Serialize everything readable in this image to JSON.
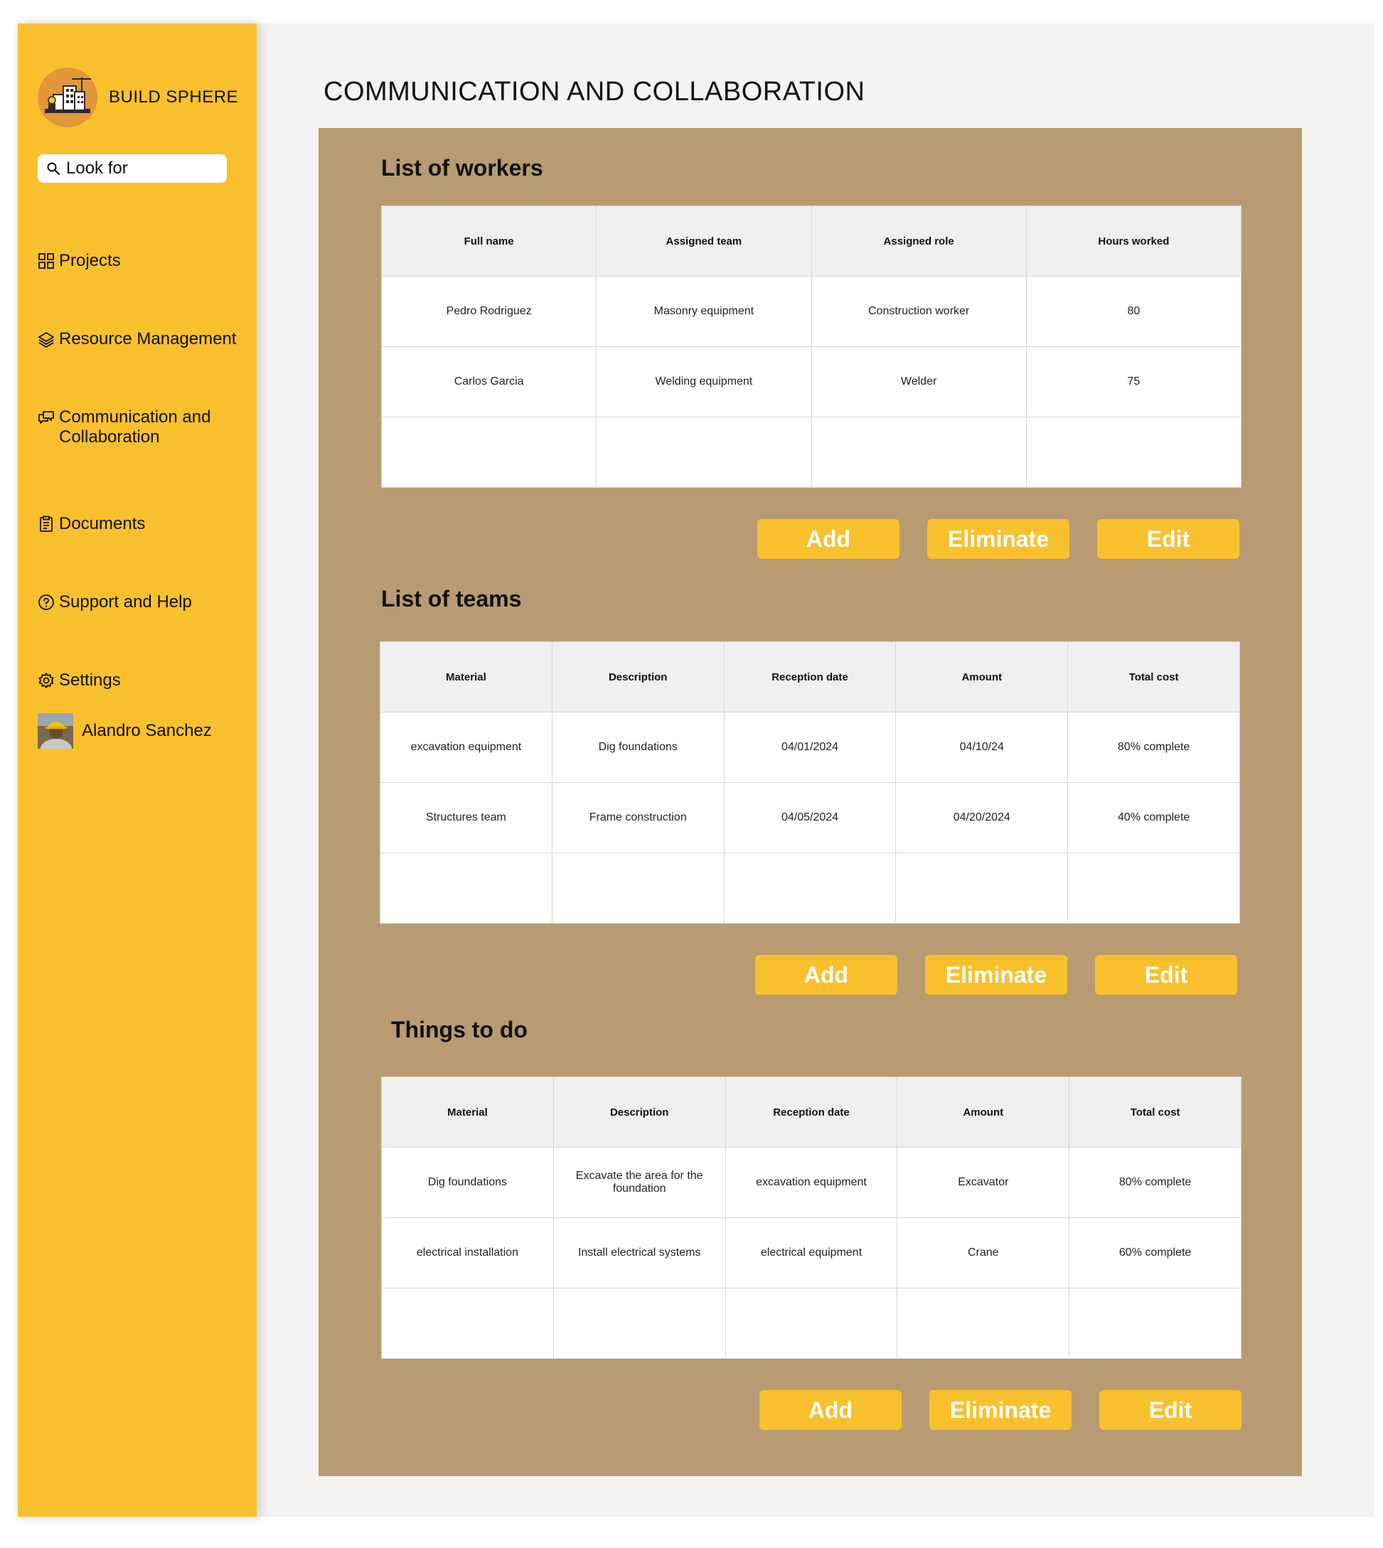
{
  "app": {
    "brand_name": "BUILD SPHERE"
  },
  "search": {
    "placeholder": "Look for"
  },
  "nav": {
    "projects": "Projects",
    "resources": "Resource Management",
    "communication": "Communication and Collaboration",
    "documents": "Documents",
    "support": "Support and Help",
    "settings": "Settings"
  },
  "user": {
    "name": "Alandro Sanchez"
  },
  "page": {
    "title": "COMMUNICATION AND COLLABORATION"
  },
  "workers": {
    "title": "List of workers",
    "headers": [
      "Full name",
      "Assigned team",
      "Assigned role",
      "Hours worked"
    ],
    "rows": [
      [
        "Pedro Rodriguez",
        "Masonry equipment",
        "Construction worker",
        "80"
      ],
      [
        "Carlos Garcia",
        "Welding equipment",
        "Welder",
        "75"
      ],
      [
        "",
        "",
        "",
        ""
      ]
    ]
  },
  "teams": {
    "title": "List of teams",
    "headers": [
      "Material",
      "Description",
      "Reception date",
      "Amount",
      "Total cost"
    ],
    "rows": [
      [
        "excavation equipment",
        "Dig foundations",
        "04/01/2024",
        "04/10/24",
        "80% complete"
      ],
      [
        "Structures team",
        "Frame construction",
        "04/05/2024",
        "04/20/2024",
        "40% complete"
      ],
      [
        "",
        "",
        "",
        "",
        ""
      ]
    ]
  },
  "todo": {
    "title": "Things to do",
    "headers": [
      "Material",
      "Description",
      "Reception date",
      "Amount",
      "Total cost"
    ],
    "rows": [
      [
        "Dig foundations",
        "Excavate the area for the foundation",
        "excavation equipment",
        "Excavator",
        "80% complete"
      ],
      [
        "electrical installation",
        "Install electrical systems",
        "electrical equipment",
        "Crane",
        "60% complete"
      ],
      [
        "",
        "",
        "",
        "",
        ""
      ]
    ]
  },
  "actions": {
    "add": "Add",
    "eliminate": "Eliminate",
    "edit": "Edit"
  },
  "colors": {
    "sidebar": "#f9c02e",
    "panel": "#b89b72",
    "accent": "#f9c02e",
    "background": "#f5f3f1"
  }
}
